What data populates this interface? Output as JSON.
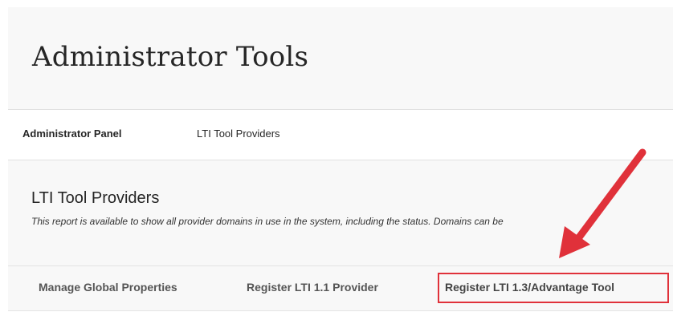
{
  "header": {
    "title": "Administrator Tools"
  },
  "breadcrumb": {
    "items": [
      {
        "label": "Administrator Panel"
      },
      {
        "label": "LTI Tool Providers"
      }
    ]
  },
  "section": {
    "title": "LTI Tool Providers",
    "description": "This report is available to show all provider domains in use in the system, including the status. Domains can be"
  },
  "tabs": {
    "items": [
      {
        "label": "Manage Global Properties"
      },
      {
        "label": "Register LTI 1.1 Provider"
      },
      {
        "label": "Register LTI 1.3/Advantage Tool"
      }
    ]
  },
  "annotation": {
    "color": "#e0313a",
    "icon": "arrow-icon"
  }
}
